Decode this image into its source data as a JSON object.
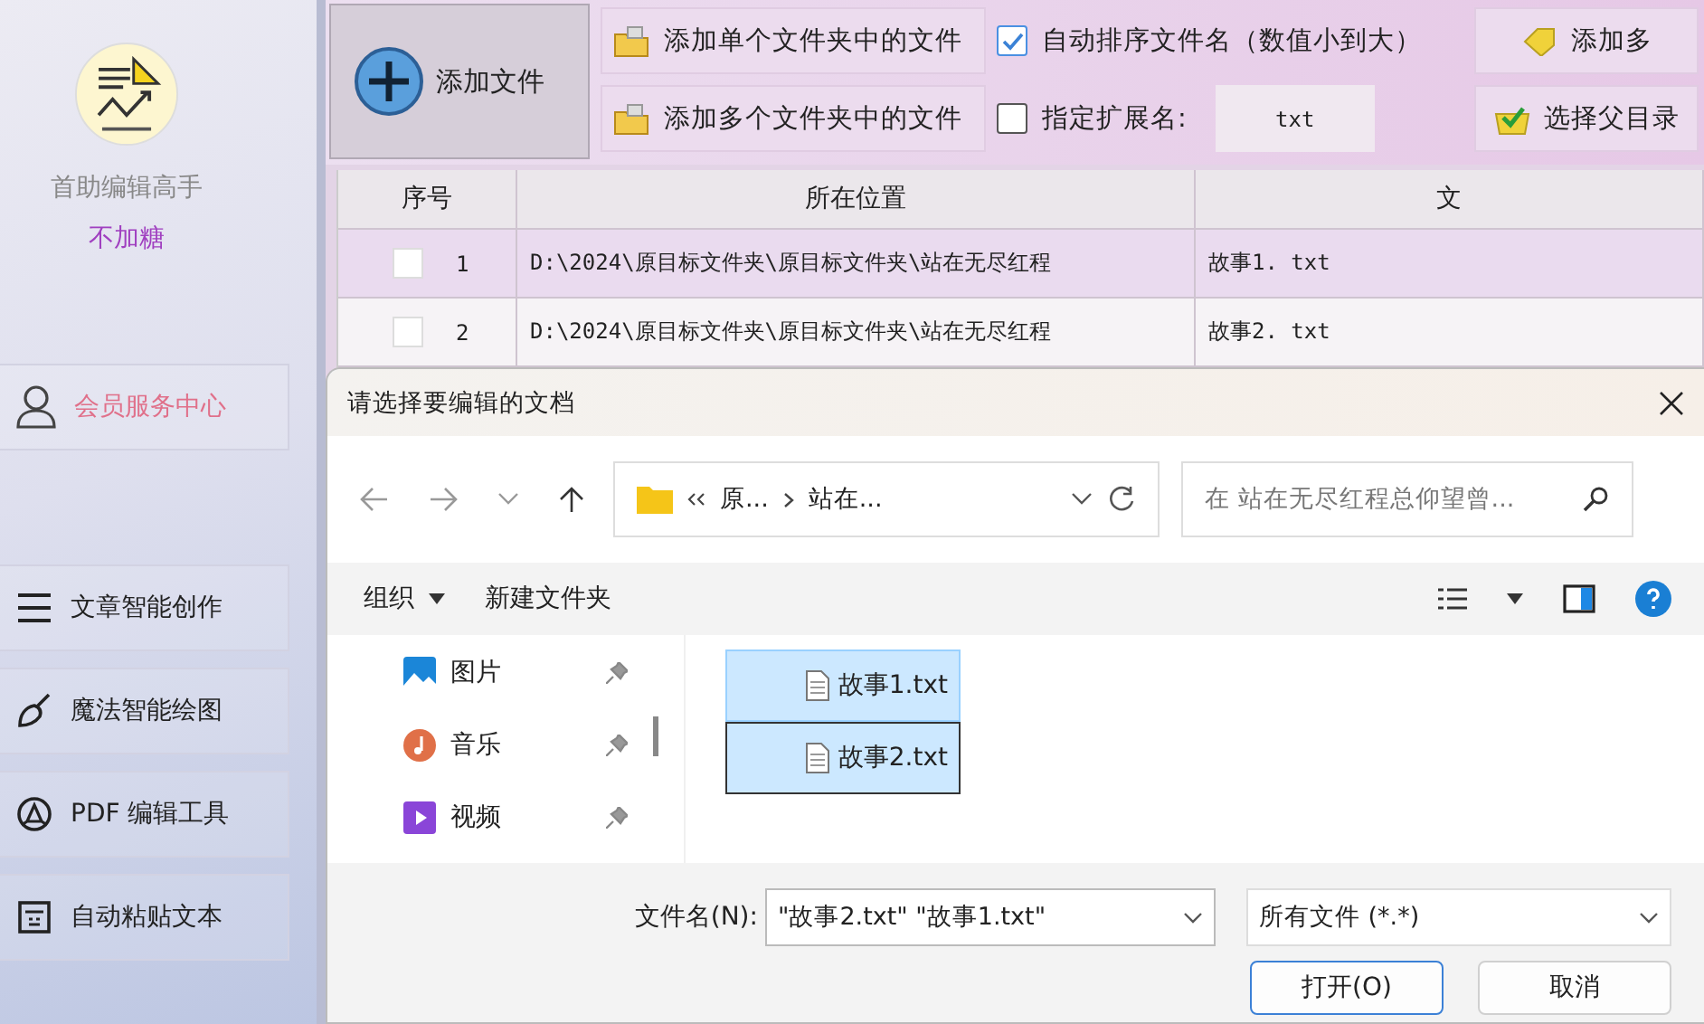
{
  "sidebar": {
    "app_name": "首助编辑高手",
    "user_name": "不加糖",
    "member_item": {
      "label": "会员服务中心"
    },
    "items": [
      {
        "label": "文章智能创作"
      },
      {
        "label": "魔法智能绘图"
      },
      {
        "label": "PDF 编辑工具"
      },
      {
        "label": "自动粘贴文本"
      }
    ]
  },
  "toolbar": {
    "add_file_button": "添加文件",
    "folder_buttons": [
      "添加单个文件夹中的文件",
      "添加多个文件夹中的文件"
    ],
    "options": [
      {
        "kind": "checkbox",
        "label": "自动排序文件名（数值小到大）",
        "checked": true
      },
      {
        "kind": "extension",
        "label": "指定扩展名:",
        "checked": false,
        "value": "txt"
      }
    ],
    "right_buttons": [
      {
        "kind": "tag",
        "label": "添加多"
      },
      {
        "kind": "folder",
        "label": "选择父目录"
      }
    ]
  },
  "table": {
    "columns": [
      "序号",
      "所在位置",
      "文"
    ],
    "rows": [
      {
        "index": "1",
        "checked": false,
        "selected": true,
        "path": "D:\\2024\\原目标文件夹\\原目标文件夹\\站在无尽红程",
        "name": "故事1. txt"
      },
      {
        "index": "2",
        "checked": false,
        "selected": false,
        "path": "D:\\2024\\原目标文件夹\\原目标文件夹\\站在无尽红程",
        "name": "故事2. txt"
      }
    ]
  },
  "dialog": {
    "title": "请选择要编辑的文档",
    "breadcrumb": [
      "原...",
      "站在..."
    ],
    "search": {
      "placeholder": "在 站在无尽红程总仰望曾..."
    },
    "commands": [
      {
        "label": "组织",
        "dropdown": true
      },
      {
        "label": "新建文件夹",
        "dropdown": false
      }
    ],
    "nav_items": [
      {
        "label": "图片",
        "kind": "pictures"
      },
      {
        "label": "音乐",
        "kind": "music"
      },
      {
        "label": "视频",
        "kind": "videos"
      }
    ],
    "files": [
      {
        "name": "故事1.txt",
        "selected": true
      },
      {
        "name": "故事2.txt",
        "selected": true
      }
    ],
    "filename_label": "文件名(N):",
    "filename_value": "\"故事2.txt\" \"故事1.txt\"",
    "filetype": "所有文件 (*.*)",
    "open_button": "打开(O)",
    "cancel_button": "取消"
  }
}
